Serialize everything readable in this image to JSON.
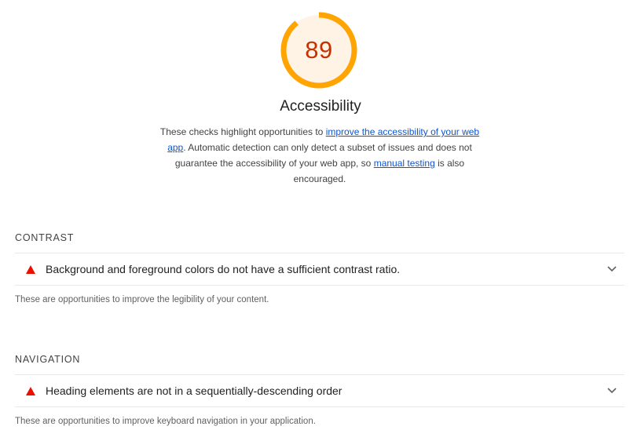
{
  "score": {
    "value": "89",
    "fraction": 0.89,
    "color": "#ffa400",
    "text_color": "#c33300",
    "fill": "#fff3e6"
  },
  "category": {
    "title": "Accessibility",
    "description": {
      "part1": "These checks highlight opportunities to ",
      "link1": "improve the accessibility of your web app",
      "part2": ". Automatic detection can only detect a subset of issues and does not guarantee the accessibility of your web app, so ",
      "link2": "manual testing",
      "part3": " is also encouraged."
    }
  },
  "groups": [
    {
      "title": "CONTRAST",
      "audit": {
        "icon": "fail-triangle-icon",
        "title": "Background and foreground colors do not have a sufficient contrast ratio."
      },
      "description": "These are opportunities to improve the legibility of your content."
    },
    {
      "title": "NAVIGATION",
      "audit": {
        "icon": "fail-triangle-icon",
        "title": "Heading elements are not in a sequentially-descending order"
      },
      "description": "These are opportunities to improve keyboard navigation in your application."
    }
  ]
}
